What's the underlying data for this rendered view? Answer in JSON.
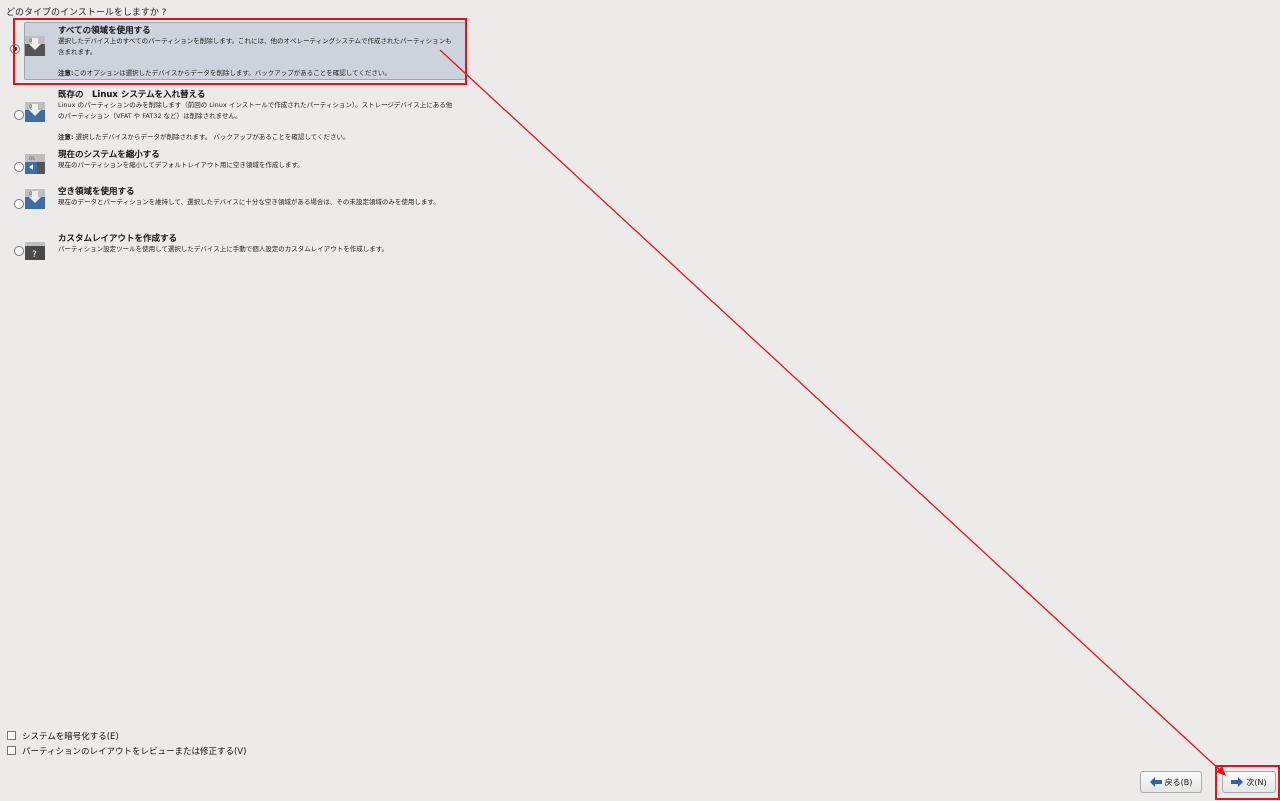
{
  "question": "どのタイプのインストールをしますか ?",
  "options": [
    {
      "title": "すべての領域を使用する",
      "desc": "選択したデバイス上のすべてのパーティションを削除します。これには、他のオペレーティングシステムで作成されたパーティションも含まれます。",
      "note_label": "注意:",
      "note_text": "このオプションは選択したデバイスからデータを削除します。バックアップがあることを確認してください。",
      "icon": "disk-erase-icon",
      "selected": true
    },
    {
      "title": "既存の　Linux システムを入れ替える",
      "desc": "Linux のパーティションのみを削除します（前回の Linux インストールで作成されたパーティション）。ストレージデバイス上にある他のパーティション（VFAT や FAT32 など）は削除されません。",
      "note_label": "注意:",
      "note_text": " 選択したデバイスからデータが削除されます。 バックアップがあることを確認してください。",
      "icon": "disk-replace-icon",
      "selected": false
    },
    {
      "title": "現在のシステムを縮小する",
      "desc": "現在のパーティションを縮小してデフォルトレイアウト用に空き領域を作成します。",
      "icon": "disk-shrink-icon",
      "selected": false
    },
    {
      "title": "空き領域を使用する",
      "desc": "現在のデータとパーティションを維持して、選択したデバイスに十分な空き領域がある場合は、その未設定領域のみを使用します。",
      "icon": "disk-free-space-icon",
      "selected": false
    },
    {
      "title": "カスタムレイアウトを作成する",
      "desc": "パーティション設定ツールを使用して選択したデバイス上に手動で個人設定のカスタムレイアウトを作成します。",
      "icon": "disk-custom-icon",
      "selected": false
    }
  ],
  "checkboxes": [
    {
      "label": "システムを暗号化する(E)",
      "checked": false
    },
    {
      "label": "パーティションのレイアウトをレビューまたは修正する(V)",
      "checked": false
    }
  ],
  "buttons": {
    "back_label": "戻る(B)",
    "next_label": "次(N)"
  },
  "colors": {
    "highlight": "#e0141e",
    "background": "#edebe9",
    "selected_option": "#cdd3dc"
  }
}
